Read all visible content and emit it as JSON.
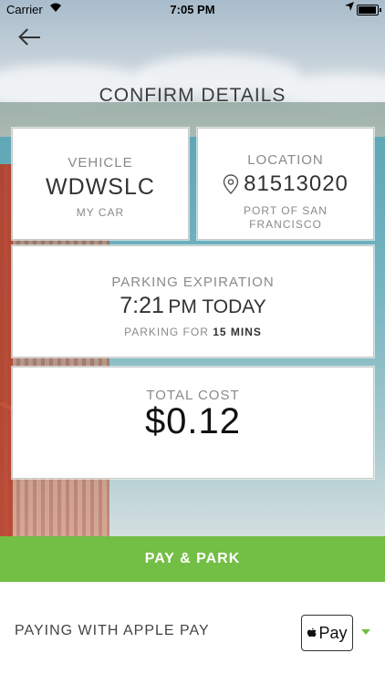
{
  "status_bar": {
    "carrier": "Carrier",
    "time": "7:05 PM"
  },
  "page": {
    "title": "CONFIRM DETAILS"
  },
  "vehicle": {
    "label": "VEHICLE",
    "plate": "WDWSLC",
    "name": "MY CAR"
  },
  "location": {
    "label": "LOCATION",
    "zone": "81513020",
    "place_line1": "PORT OF SAN",
    "place_line2": "FRANCISCO"
  },
  "expiration": {
    "label": "PARKING EXPIRATION",
    "time": "7:21",
    "suffix": "PM TODAY",
    "duration_prefix": "PARKING FOR",
    "duration": "15 MINS"
  },
  "cost": {
    "label": "TOTAL COST",
    "amount": "$0.12"
  },
  "actions": {
    "pay_label": "PAY & PARK"
  },
  "payment": {
    "label": "PAYING WITH APPLE PAY",
    "method_text": "Pay"
  },
  "colors": {
    "accent": "#73be44"
  },
  "icons": {
    "back": "back-arrow-icon",
    "pin": "location-pin-icon",
    "apple": "apple-logo-icon",
    "dropdown": "caret-down-icon"
  }
}
